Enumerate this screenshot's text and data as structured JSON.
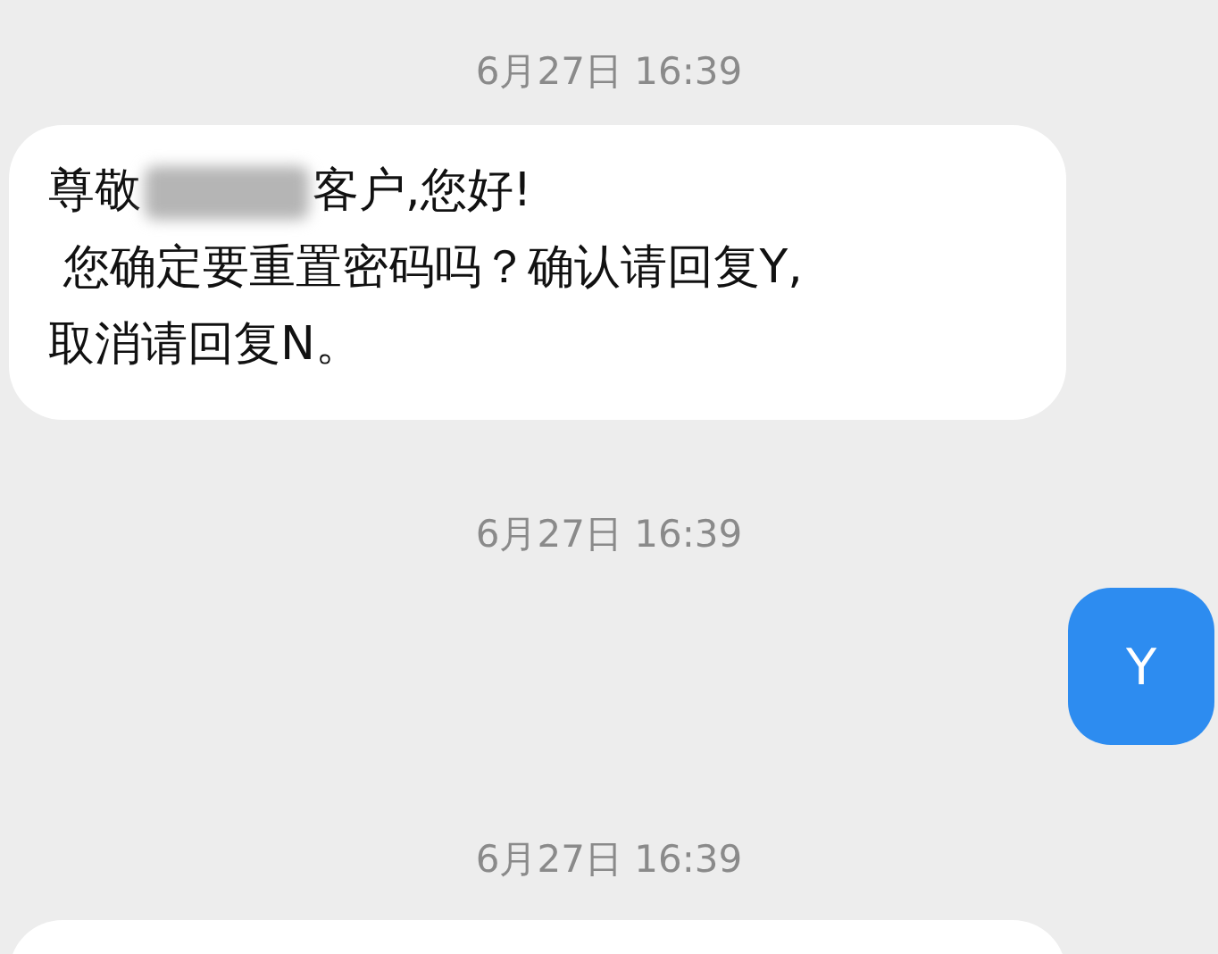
{
  "messages": [
    {
      "kind": "timestamp",
      "text": "6月27日 16:39"
    },
    {
      "kind": "incoming",
      "lines": [
        {
          "segments": [
            {
              "kind": "text",
              "text": "尊敬"
            },
            {
              "kind": "redacted"
            },
            {
              "kind": "text",
              "text": "客户,您好!"
            }
          ]
        },
        {
          "segments": [
            {
              "kind": "text",
              "text": " 您确定要重置密码吗？确认请回复Y,"
            }
          ]
        },
        {
          "segments": [
            {
              "kind": "text",
              "text": "取消请回复N。"
            }
          ]
        }
      ]
    },
    {
      "kind": "timestamp",
      "text": "6月27日 16:39"
    },
    {
      "kind": "outgoing",
      "lines": [
        {
          "segments": [
            {
              "kind": "text",
              "text": "Y"
            }
          ]
        }
      ]
    },
    {
      "kind": "timestamp",
      "text": "6月27日 16:39"
    },
    {
      "kind": "incoming"
    }
  ]
}
